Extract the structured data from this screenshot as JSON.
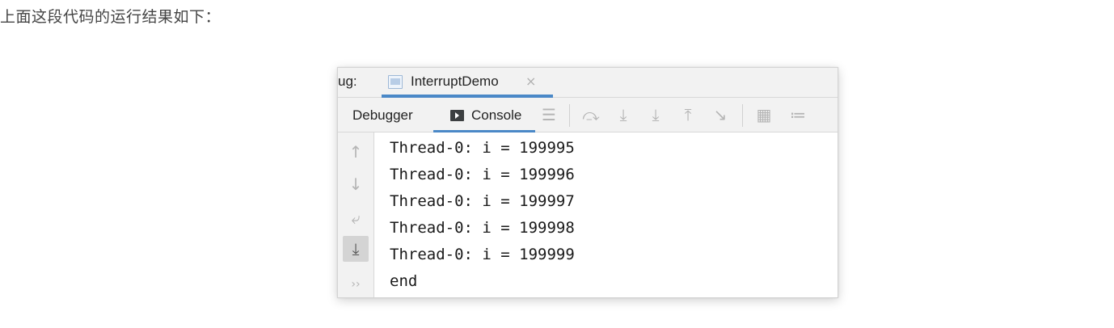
{
  "intro_text": "上面这段代码的运行结果如下：",
  "window": {
    "panel_title": "ug:",
    "run_tab": {
      "label": "InterruptDemo",
      "close_glyph": "×"
    },
    "toolbar": {
      "tabs": [
        {
          "label": "Debugger",
          "active": false
        },
        {
          "label": "Console",
          "active": true,
          "icon": "console-icon"
        }
      ],
      "actions": [
        {
          "name": "list-icon",
          "glyph": "☰"
        },
        {
          "name": "step-over-icon",
          "glyph": "⤼"
        },
        {
          "name": "step-into-icon",
          "glyph": "⤓"
        },
        {
          "name": "force-step-into-icon",
          "glyph": "⤓"
        },
        {
          "name": "step-out-icon",
          "glyph": "⤒"
        },
        {
          "name": "run-to-cursor-icon",
          "glyph": "↘"
        },
        {
          "name": "evaluate-expression-icon",
          "glyph": "▦"
        },
        {
          "name": "trace-icon",
          "glyph": "≔"
        }
      ]
    },
    "gutter_icons": [
      {
        "name": "scroll-up-icon",
        "glyph": "↑",
        "active": false
      },
      {
        "name": "scroll-down-icon",
        "glyph": "↓",
        "active": false
      },
      {
        "name": "soft-wrap-icon",
        "glyph": "⤶",
        "active": false
      },
      {
        "name": "scroll-to-end-icon",
        "glyph": "⤓",
        "active": true
      },
      {
        "name": "more-icon",
        "glyph": "››",
        "active": false
      }
    ],
    "console_lines": [
      "Thread-0: i = 199995",
      "Thread-0: i = 199996",
      "Thread-0: i = 199997",
      "Thread-0: i = 199998",
      "Thread-0: i = 199999",
      "end"
    ]
  },
  "colors": {
    "accent": "#4a88c7",
    "panel_bg": "#f2f2f2",
    "text": "#1a1a1a",
    "icon_muted": "#b5b5b5"
  }
}
